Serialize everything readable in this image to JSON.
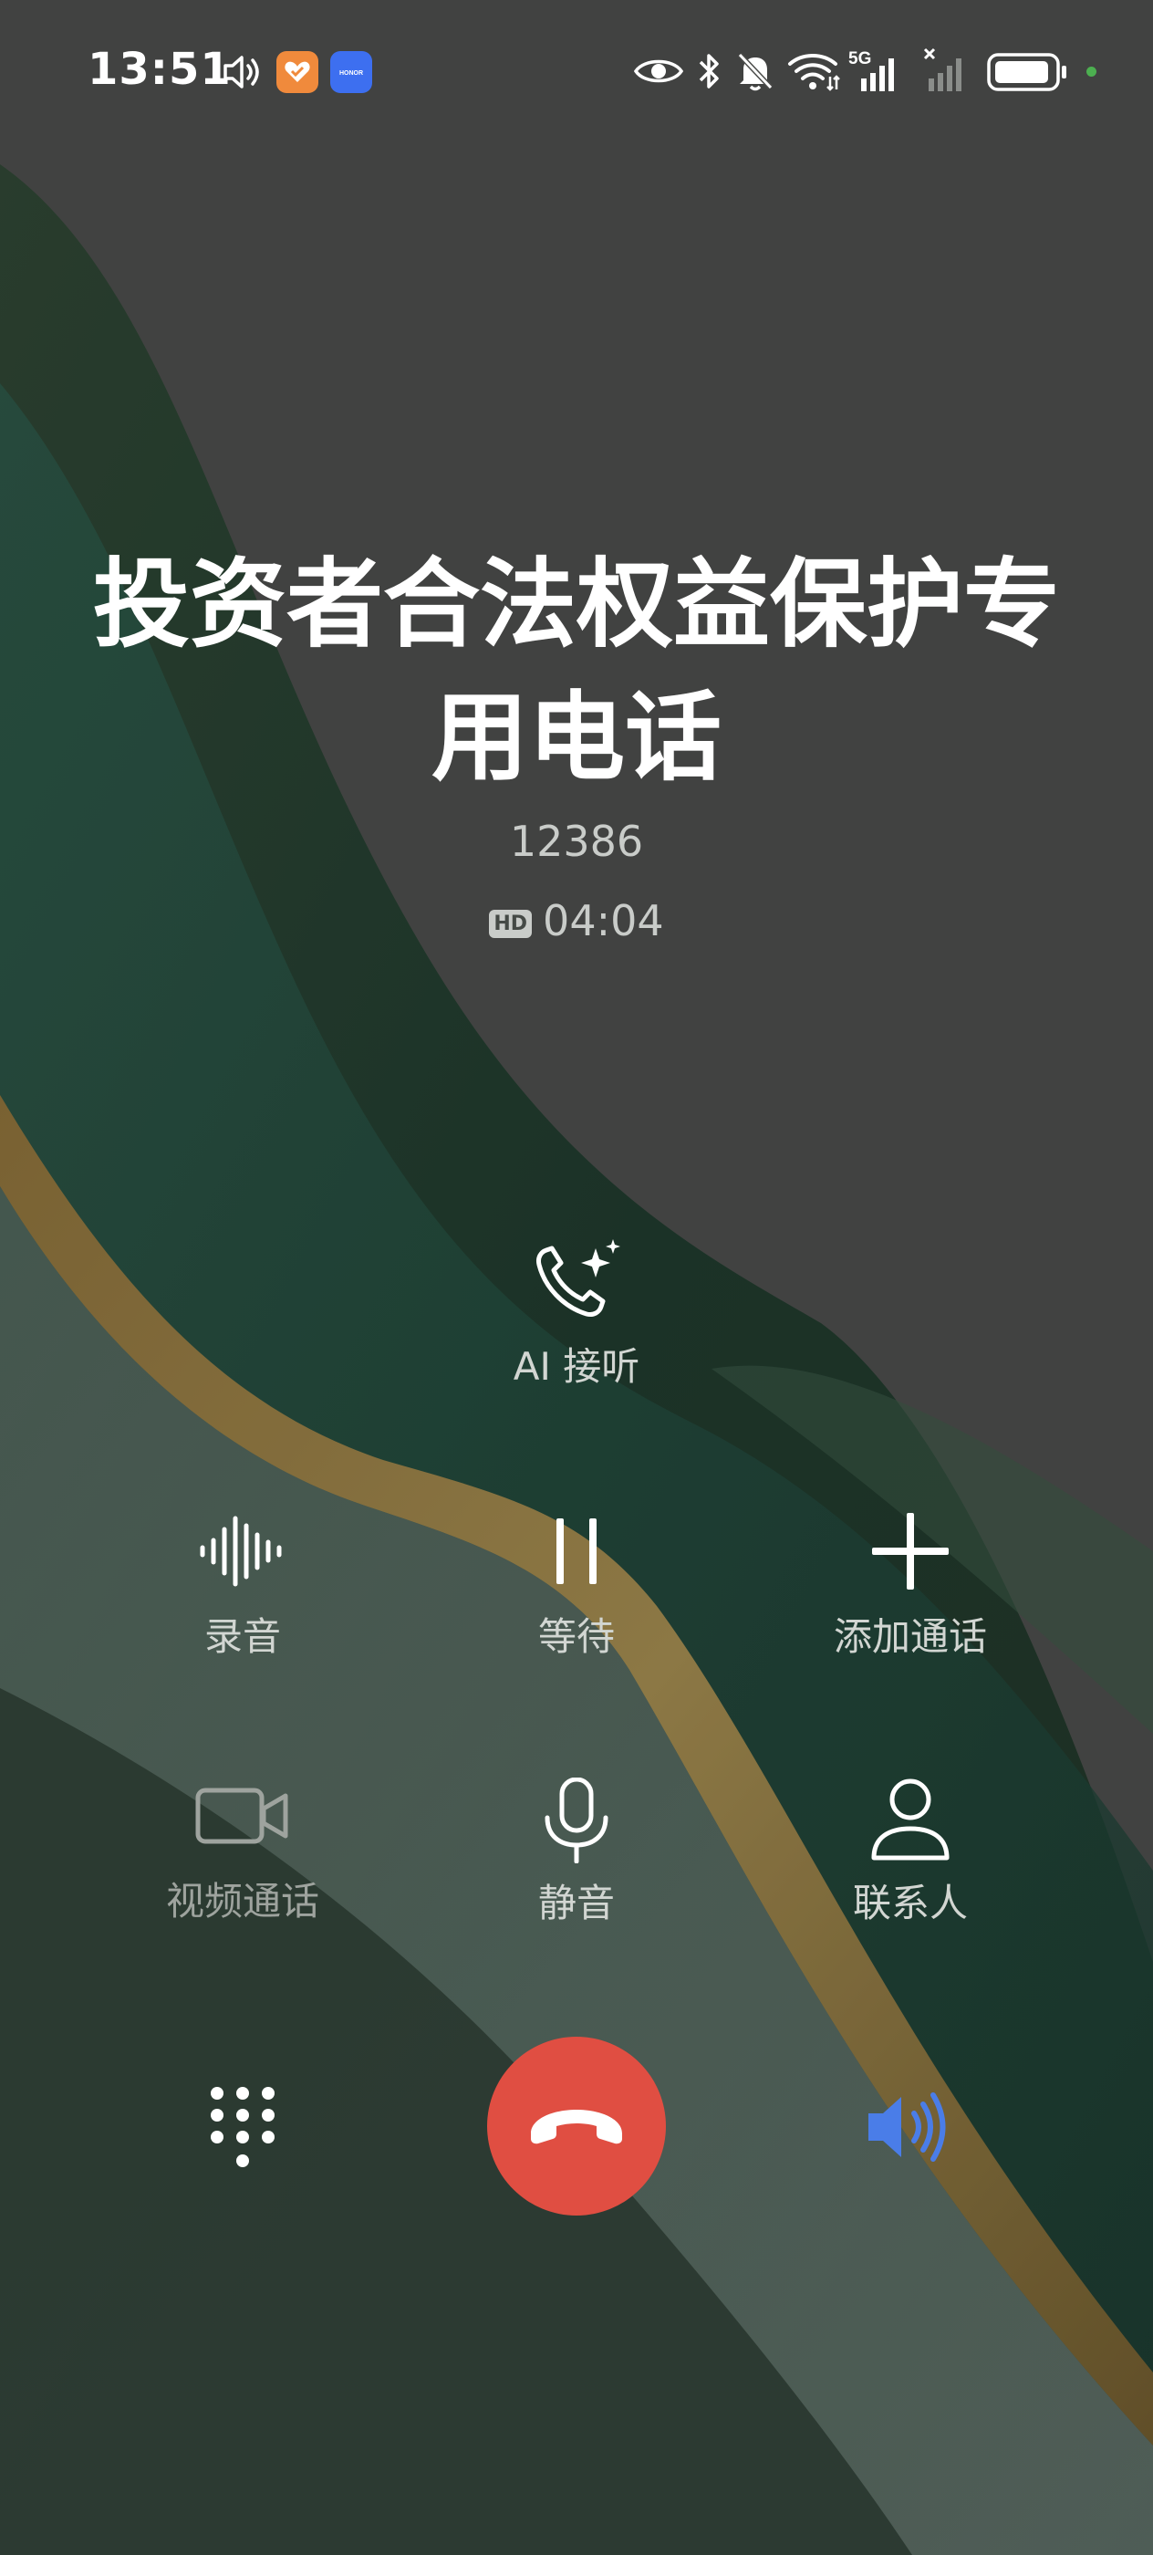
{
  "status_bar": {
    "time": "13:51",
    "icons": [
      "volume-icon",
      "health-app-icon",
      "honor-app-icon",
      "eye-icon",
      "bluetooth-icon",
      "mute-bell-icon",
      "wifi-icon",
      "5g-signal-icon",
      "no-signal-icon",
      "battery-icon"
    ],
    "honor_label": "HONOR",
    "network_label": "5G",
    "indicator_color": "#4caf50"
  },
  "call": {
    "caller_line1": "投资者合法权益保护专",
    "caller_line2": "用电话",
    "number": "12386",
    "hd_label": "HD",
    "duration": "04:04"
  },
  "actions": {
    "ai_answer": "AI 接听",
    "record": "录音",
    "hold": "等待",
    "add_call": "添加通话",
    "video_call": "视频通话",
    "mute": "静音",
    "contacts": "联系人"
  },
  "colors": {
    "end_call": "#e04e42",
    "speaker_active": "#4a7de8"
  }
}
